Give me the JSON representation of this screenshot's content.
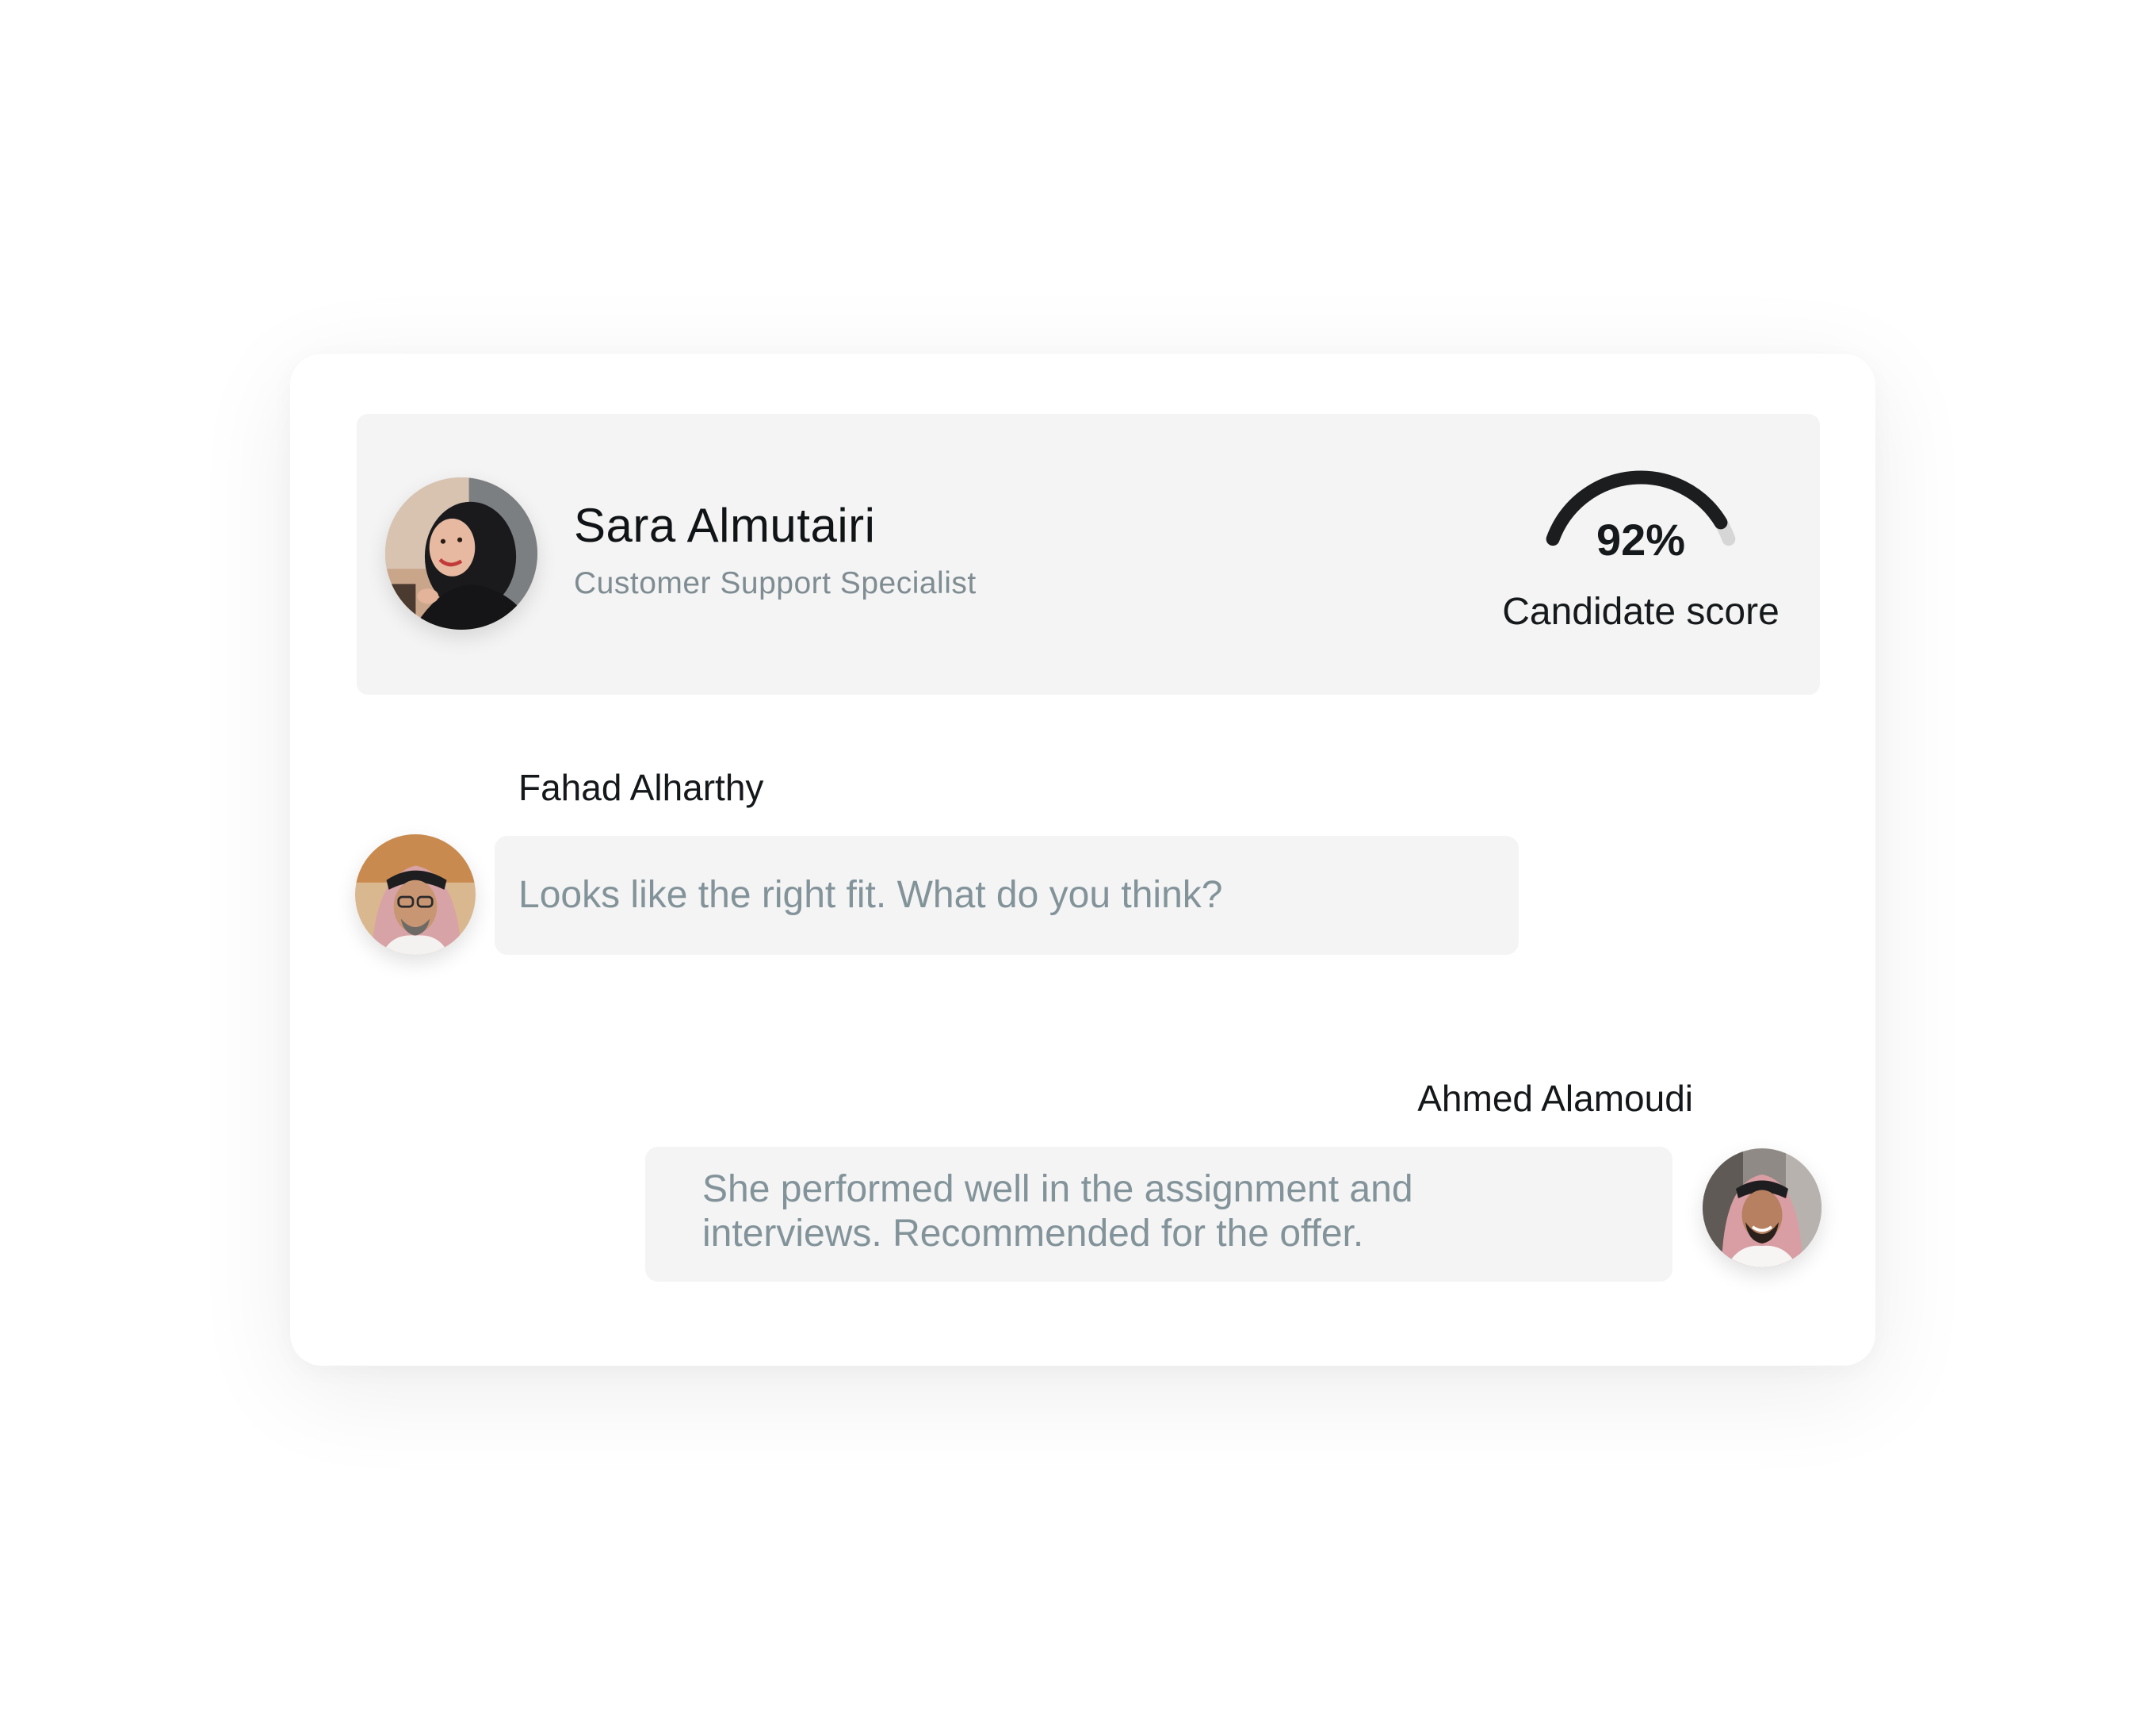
{
  "candidate": {
    "name": "Sara Almutairi",
    "role": "Customer Support Specialist",
    "avatar_icon": "candidate-photo-avatar"
  },
  "score": {
    "value_label": "92%",
    "value": 92,
    "label": "Candidate score",
    "accent_color": "#1b1d1f",
    "track_color": "#d6d6d6"
  },
  "messages": [
    {
      "sender": "Fahad Alharthy",
      "text": "Looks like the right fit. What do you think?",
      "align": "left",
      "avatar_icon": "reviewer-photo-avatar"
    },
    {
      "sender": "Ahmed Alamoudi",
      "text": "She performed well in the assignment and interviews. Recommended for the offer.",
      "align": "right",
      "avatar_icon": "reviewer-photo-avatar"
    }
  ],
  "colors": {
    "panel_bg": "#f4f4f4",
    "muted_text": "#82939a",
    "primary_text": "#111416"
  }
}
